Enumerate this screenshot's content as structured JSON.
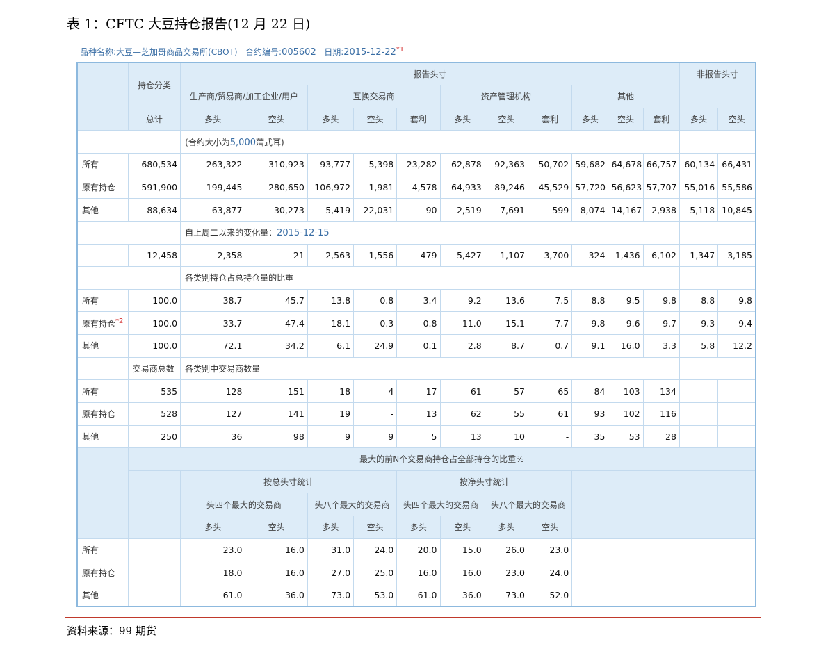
{
  "title": "表 1：CFTC 大豆持仓报告(12 月 22 日)",
  "info": {
    "label_product": "品种名称:",
    "product": "大豆—芝加哥商品交易所(CBOT)",
    "label_contract": "合约编号:",
    "contract": "005602",
    "label_date": "日期:",
    "date": "2015-12-22",
    "note": "*1"
  },
  "header": {
    "position_class": "持仓分类",
    "reportable": "报告头寸",
    "nonreportable": "非报告头寸",
    "groups": [
      "生产商/贸易商/加工企业/用户",
      "互换交易商",
      "资产管理机构",
      "其他"
    ],
    "total": "总计",
    "cols": [
      "多头",
      "空头",
      "多头",
      "空头",
      "套利",
      "多头",
      "空头",
      "套利",
      "多头",
      "空头",
      "套利",
      "多头",
      "空头"
    ]
  },
  "section1": {
    "prefix": "(合约大小为",
    "size": "5,000",
    "suffix": "蒲式耳)",
    "rows": [
      {
        "label": "所有",
        "values": [
          "680,534",
          "263,322",
          "310,923",
          "93,777",
          "5,398",
          "23,282",
          "62,878",
          "92,363",
          "50,702",
          "59,682",
          "64,678",
          "66,757",
          "60,134",
          "66,431"
        ]
      },
      {
        "label": "原有持仓",
        "values": [
          "591,900",
          "199,445",
          "280,650",
          "106,972",
          "1,981",
          "4,578",
          "64,933",
          "89,246",
          "45,529",
          "57,720",
          "56,623",
          "57,707",
          "55,016",
          "55,586"
        ]
      },
      {
        "label": "其他",
        "values": [
          "88,634",
          "63,877",
          "30,273",
          "5,419",
          "22,031",
          "90",
          "2,519",
          "7,691",
          "599",
          "8,074",
          "14,167",
          "2,938",
          "5,118",
          "10,845"
        ]
      }
    ]
  },
  "section2": {
    "prefix": "自上周二以来的变化量：",
    "date": "2015-12-15",
    "values": [
      "-12,458",
      "2,358",
      "21",
      "2,563",
      "-1,556",
      "-479",
      "-5,427",
      "1,107",
      "-3,700",
      "-324",
      "1,436",
      "-6,102",
      "-1,347",
      "-3,185"
    ]
  },
  "section3": {
    "title": "各类别持仓占总持仓量的比重",
    "rows": [
      {
        "label": "所有",
        "note": "",
        "values": [
          "100.0",
          "38.7",
          "45.7",
          "13.8",
          "0.8",
          "3.4",
          "9.2",
          "13.6",
          "7.5",
          "8.8",
          "9.5",
          "9.8",
          "8.8",
          "9.8"
        ]
      },
      {
        "label": "原有持仓",
        "note": "*2",
        "values": [
          "100.0",
          "33.7",
          "47.4",
          "18.1",
          "0.3",
          "0.8",
          "11.0",
          "15.1",
          "7.7",
          "9.8",
          "9.6",
          "9.7",
          "9.3",
          "9.4"
        ]
      },
      {
        "label": "其他",
        "note": "",
        "values": [
          "100.0",
          "72.1",
          "34.2",
          "6.1",
          "24.9",
          "0.1",
          "2.8",
          "8.7",
          "0.7",
          "9.1",
          "16.0",
          "3.3",
          "5.8",
          "12.2"
        ]
      }
    ]
  },
  "section4": {
    "total_label": "交易商总数",
    "title": "各类别中交易商数量",
    "rows": [
      {
        "label": "所有",
        "values": [
          "535",
          "128",
          "151",
          "18",
          "4",
          "17",
          "61",
          "57",
          "65",
          "84",
          "103",
          "134"
        ]
      },
      {
        "label": "原有持仓",
        "values": [
          "528",
          "127",
          "141",
          "19",
          "-",
          "13",
          "62",
          "55",
          "61",
          "93",
          "102",
          "116"
        ]
      },
      {
        "label": "其他",
        "values": [
          "250",
          "36",
          "98",
          "9",
          "9",
          "5",
          "13",
          "10",
          "-",
          "35",
          "53",
          "28"
        ]
      }
    ]
  },
  "section5": {
    "title_prefix": "最大的前",
    "title_n": "N",
    "title_suffix": "个交易商持仓占全部持仓的比重",
    "title_pct": "%",
    "gross": "按总头寸统计",
    "net": "按净头寸统计",
    "top4": "头四个最大的交易商",
    "top8": "头八个最大的交易商",
    "long": "多头",
    "short": "空头",
    "rows": [
      {
        "label": "所有",
        "values": [
          "23.0",
          "16.0",
          "31.0",
          "24.0",
          "20.0",
          "15.0",
          "26.0",
          "23.0"
        ]
      },
      {
        "label": "原有持仓",
        "values": [
          "18.0",
          "16.0",
          "27.0",
          "25.0",
          "16.0",
          "16.0",
          "23.0",
          "24.0"
        ]
      },
      {
        "label": "其他",
        "values": [
          "61.0",
          "36.0",
          "73.0",
          "53.0",
          "61.0",
          "36.0",
          "73.0",
          "52.0"
        ]
      }
    ]
  },
  "source": "资料来源：99 期货"
}
